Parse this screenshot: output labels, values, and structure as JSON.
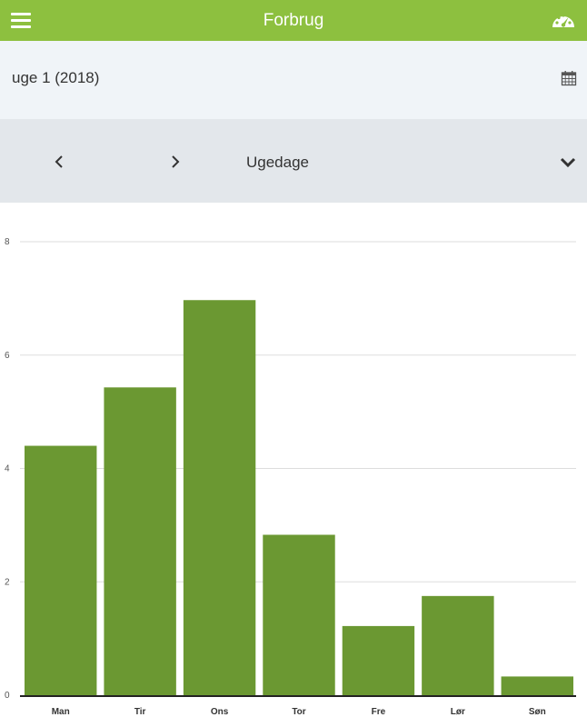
{
  "header": {
    "title": "Forbrug",
    "menu_icon": "hamburger-menu-icon",
    "dashboard_icon": "gauge-icon"
  },
  "period": {
    "label": "uge 1 (2018)",
    "calendar_icon": "calendar-icon"
  },
  "navigation": {
    "prev_icon": "chevron-left-icon",
    "next_icon": "chevron-right-icon",
    "view_label": "Ugedage",
    "dropdown_icon": "chevron-down-icon"
  },
  "colors": {
    "header": "#8dc03f",
    "bar": "#6b9832",
    "week_bar_bg": "#f0f4f8",
    "nav_bar_bg": "#e3e7eb"
  },
  "chart_data": {
    "type": "bar",
    "categories": [
      "Man",
      "Tir",
      "Ons",
      "Tor",
      "Fre",
      "Lør",
      "Søn"
    ],
    "values": [
      4.4,
      5.43,
      6.97,
      2.83,
      1.22,
      1.75,
      0.33
    ],
    "ylim": [
      0,
      8
    ],
    "yticks": [
      "0",
      "2",
      "4",
      "6",
      "8"
    ],
    "grid": true,
    "legend": "none"
  }
}
